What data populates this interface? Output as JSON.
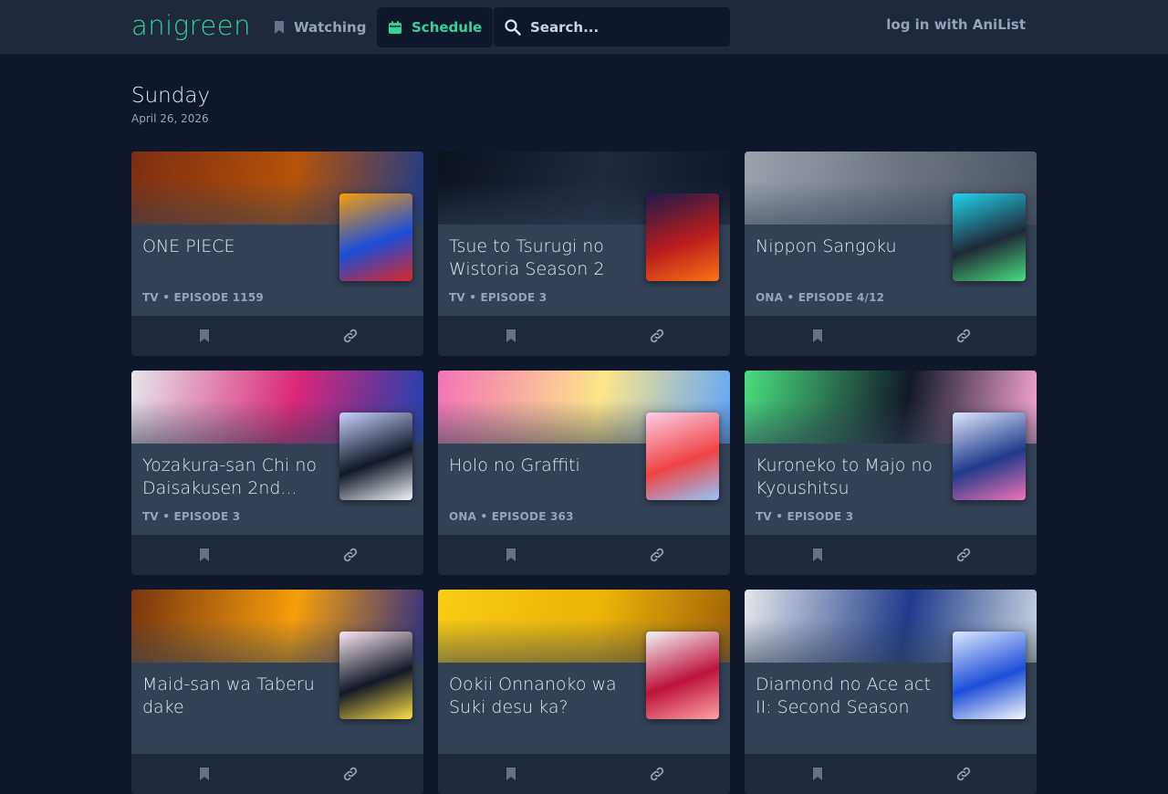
{
  "header": {
    "logo": "anigreen",
    "nav": [
      {
        "label": "Watching",
        "icon": "bookmark-icon"
      },
      {
        "label": "Schedule",
        "icon": "calendar-icon",
        "active": true
      }
    ],
    "search": {
      "placeholder": "Search...",
      "value": ""
    },
    "login_label": "log in with AniList"
  },
  "schedule": {
    "day": "Sunday",
    "date": "April 26, 2026"
  },
  "cards": [
    {
      "title": "ONE PIECE",
      "meta": "TV • EPISODE 1159",
      "banner": [
        "#7c2d12",
        "#b45309",
        "#1e3a8a"
      ],
      "poster": [
        "#f59e0b",
        "#1d4ed8",
        "#dc2626"
      ]
    },
    {
      "title": "Tsue to Tsurugi no Wistoria Season 2",
      "meta": "TV • EPISODE 3",
      "banner": [
        "#0b1220",
        "#1e293b",
        "#0f172a"
      ],
      "poster": [
        "#1e1b4b",
        "#b91c1c",
        "#f97316"
      ]
    },
    {
      "title": "Nippon Sangoku",
      "meta": "ONA • EPISODE 4/12",
      "banner": [
        "#9ca3af",
        "#6b7280",
        "#4b5563"
      ],
      "poster": [
        "#22d3ee",
        "#1f2937",
        "#4ade80"
      ]
    },
    {
      "title": "Yozakura-san Chi no Daisakusen 2nd...",
      "meta": "TV • EPISODE 3",
      "banner": [
        "#e5e7eb",
        "#db2777",
        "#1e40af"
      ],
      "poster": [
        "#c7d2fe",
        "#111827",
        "#f1f5f9"
      ]
    },
    {
      "title": "Holo no Graffiti",
      "meta": "ONA • EPISODE 363",
      "banner": [
        "#f472b6",
        "#fde68a",
        "#60a5fa"
      ],
      "poster": [
        "#fbcfe8",
        "#ef4444",
        "#93c5fd"
      ]
    },
    {
      "title": "Kuroneko to Majo no Kyoushitsu",
      "meta": "TV • EPISODE 3",
      "banner": [
        "#4ade80",
        "#111827",
        "#f9a8d4"
      ],
      "poster": [
        "#e0e7ff",
        "#1e3a8a",
        "#f472b6"
      ]
    },
    {
      "title": "Maid-san wa Taberu dake",
      "meta": "",
      "banner": [
        "#78350f",
        "#f59e0b",
        "#312e81"
      ],
      "poster": [
        "#fce7f3",
        "#111827",
        "#fde047"
      ]
    },
    {
      "title": "Ookii Onnanoko wa Suki desu ka?",
      "meta": "",
      "banner": [
        "#facc15",
        "#eab308",
        "#a16207"
      ],
      "poster": [
        "#f1f5f9",
        "#be123c",
        "#fca5a5"
      ]
    },
    {
      "title": "Diamond no Ace act II: Second Season",
      "meta": "",
      "banner": [
        "#e5e7eb",
        "#1e3a8a",
        "#cbd5e1"
      ],
      "poster": [
        "#dbeafe",
        "#1d4ed8",
        "#f8fafc"
      ]
    }
  ],
  "card_actions": [
    {
      "icon": "bookmark-icon"
    },
    {
      "icon": "link-icon"
    }
  ],
  "colors": {
    "accent": "#34d399",
    "background": "#0f172a",
    "surface": "#334155",
    "header": "#1e293b"
  }
}
